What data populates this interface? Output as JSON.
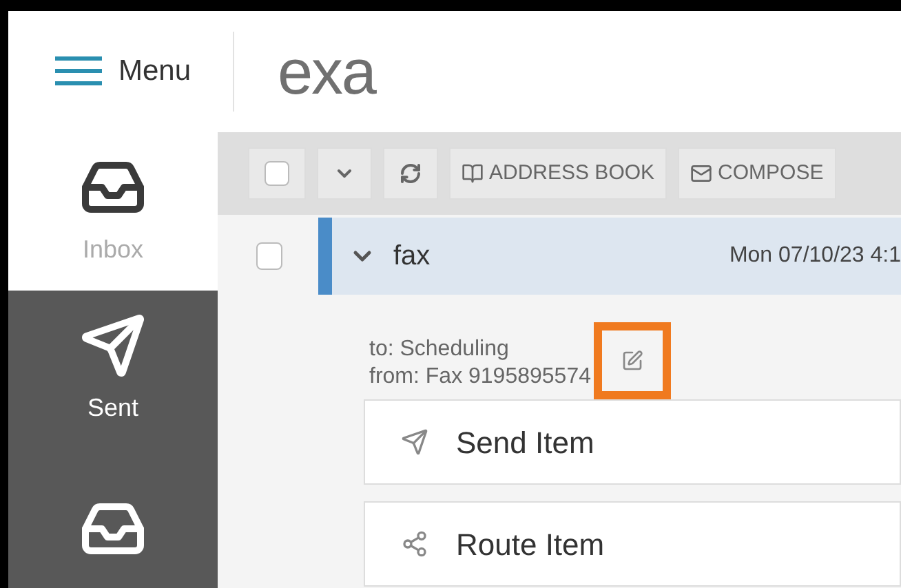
{
  "header": {
    "menu_label": "Menu",
    "logo": "exa"
  },
  "toolbar": [
    {
      "kind": "checkbox",
      "checked": false
    },
    {
      "kind": "dropdown"
    },
    {
      "kind": "refresh"
    },
    {
      "kind": "book",
      "label": "ADDRESS BOOK"
    },
    {
      "kind": "mail",
      "label": "COMPOSE"
    }
  ],
  "sidebar": {
    "items": [
      {
        "kind": "inbox",
        "label": "Inbox",
        "selected": true
      },
      {
        "kind": "sent",
        "label": "Sent",
        "selected": false
      },
      {
        "kind": "other",
        "selected": false
      }
    ]
  },
  "message": {
    "checked": false,
    "expanded": true,
    "subject": "fax",
    "date": "Mon 07/10/23 4:1",
    "to": "to: Scheduling",
    "from": "from: Fax 9195895574",
    "highlighted": true
  },
  "actions": [
    {
      "kind": "send",
      "label": "Send Item"
    },
    {
      "kind": "route",
      "label": "Route Item"
    }
  ]
}
